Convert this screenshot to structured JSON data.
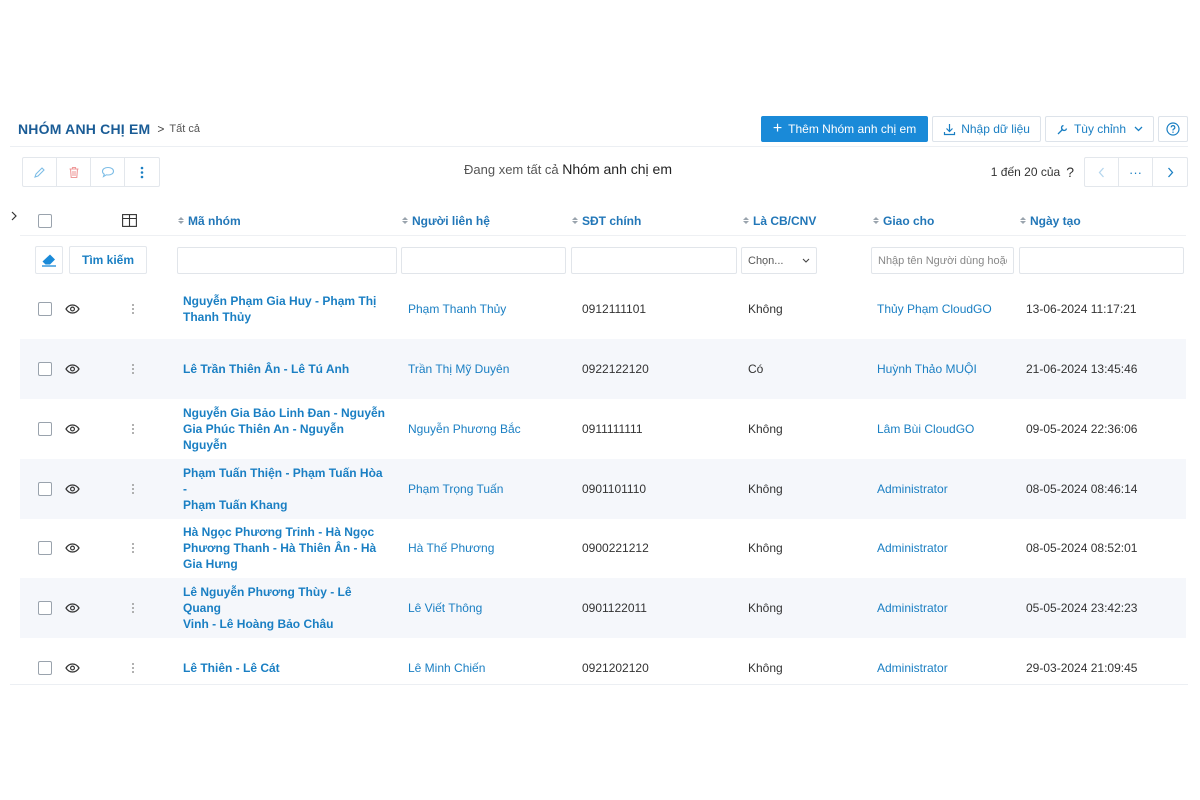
{
  "breadcrumb": {
    "module": "NHÓM ANH CHỊ EM",
    "separator": ">",
    "current": "Tất cả"
  },
  "header_actions": {
    "add_label": "Thêm Nhóm anh chị em",
    "import_label": "Nhập dữ liệu",
    "customize_label": "Tùy chỉnh",
    "help_icon": "help-icon"
  },
  "toolbar": {
    "icons": [
      "edit-icon",
      "delete-icon",
      "comment-icon",
      "more-vertical-icon"
    ],
    "viewing_prefix": "Đang xem tất cả",
    "viewing_module": "Nhóm anh chị em",
    "pager_text": "1 đến 20 của",
    "pager_unknown": "?",
    "pager_ellipsis": "···"
  },
  "columns": {
    "code": "Mã nhóm",
    "contact": "Người liên hệ",
    "phone": "SĐT chính",
    "is_staff": "Là CB/CNV",
    "assigned": "Giao cho",
    "created": "Ngày tạo"
  },
  "filters": {
    "search_label": "Tìm kiếm",
    "staff_select": "Chọn...",
    "assigned_placeholder": "Nhập tên Người dùng hoặc"
  },
  "rows": [
    {
      "code_line1": "Nguyễn Phạm Gia Huy - Phạm Thị",
      "code_line2": "Thanh Thủy",
      "code_line3": "",
      "contact": "Phạm Thanh Thủy",
      "phone": "0912111101",
      "is_staff": "Không",
      "assigned": "Thủy Phạm CloudGO",
      "created": "13-06-2024 11:17:21"
    },
    {
      "code_line1": "Lê Trần Thiên Ân - Lê Tú Anh",
      "code_line2": "",
      "code_line3": "",
      "contact": "Trần Thị Mỹ Duyên",
      "phone": "0922122120",
      "is_staff": "Có",
      "assigned": "Huỳnh Thảo MUỘI",
      "created": "21-06-2024 13:45:46"
    },
    {
      "code_line1": "Nguyễn Gia Bảo Linh Đan - Nguyễn",
      "code_line2": "Gia Phúc Thiên An - Nguyễn Nguyễn",
      "code_line3": "",
      "contact": "Nguyễn Phương Bắc",
      "phone": "0911111111",
      "is_staff": "Không",
      "assigned": "Lâm Bùi CloudGO",
      "created": "09-05-2024 22:36:06"
    },
    {
      "code_line1": "Phạm Tuấn Thiện - Phạm Tuấn Hòa -",
      "code_line2": "Phạm Tuấn Khang",
      "code_line3": "",
      "contact": "Phạm Trọng Tuấn",
      "phone": "0901101110",
      "is_staff": "Không",
      "assigned": "Administrator",
      "created": "08-05-2024 08:46:14"
    },
    {
      "code_line1": "Hà Ngọc Phương Trinh - Hà Ngọc",
      "code_line2": "Phương Thanh - Hà Thiên Ân - Hà",
      "code_line3": "Gia Hưng",
      "contact": "Hà Thế Phương",
      "phone": "0900221212",
      "is_staff": "Không",
      "assigned": "Administrator",
      "created": "08-05-2024 08:52:01"
    },
    {
      "code_line1": "Lê Nguyễn Phương Thùy - Lê Quang",
      "code_line2": "Vinh - Lê Hoàng Bảo Châu",
      "code_line3": "",
      "contact": "Lê Viết Thông",
      "phone": "0901122011",
      "is_staff": "Không",
      "assigned": "Administrator",
      "created": "05-05-2024 23:42:23"
    },
    {
      "code_line1": "Lê Thiên - Lê Cát",
      "code_line2": "",
      "code_line3": "",
      "contact": "Lê Minh Chiến",
      "phone": "0921202120",
      "is_staff": "Không",
      "assigned": "Administrator",
      "created": "29-03-2024 21:09:45"
    }
  ],
  "colors": {
    "accent": "#1a8ad8",
    "link": "#1a7fc3",
    "header_blue": "#1a5c96",
    "row_alt": "#f5f7fb"
  }
}
